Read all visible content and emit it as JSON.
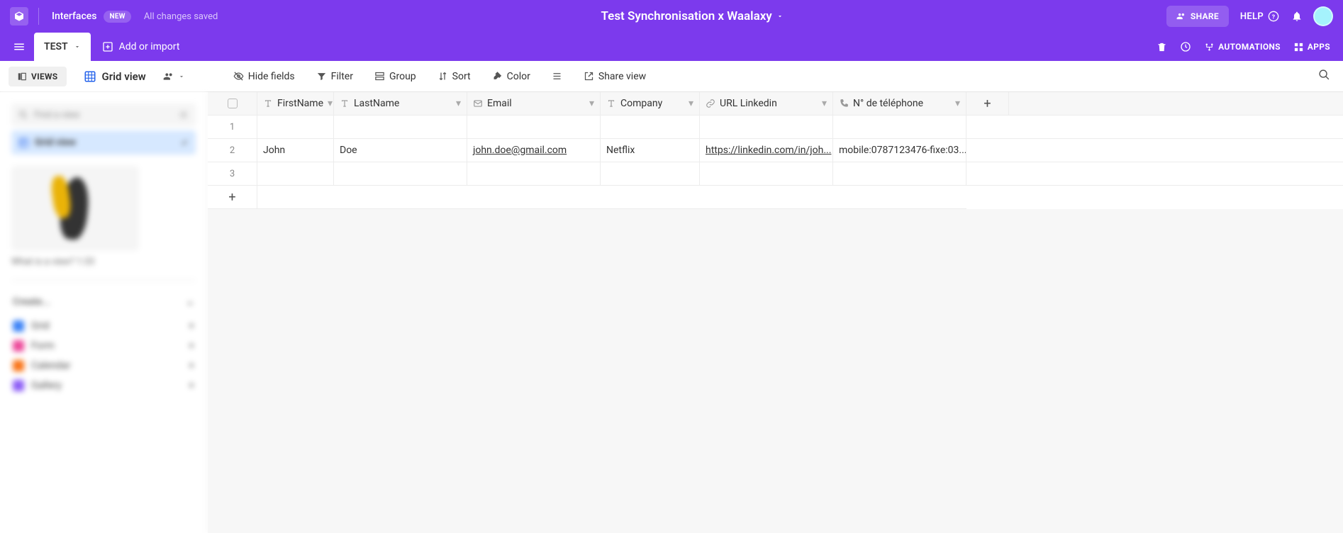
{
  "top": {
    "interfaces": "Interfaces",
    "new": "NEW",
    "saved": "All changes saved",
    "base_title": "Test Synchronisation x Waalaxy",
    "share": "SHARE",
    "help": "HELP"
  },
  "tabs": {
    "active": "TEST",
    "add": "Add or import",
    "trash": "",
    "automations": "AUTOMATIONS",
    "apps": "APPS"
  },
  "toolbar": {
    "views": "VIEWS",
    "gridview": "Grid view",
    "hide": "Hide fields",
    "filter": "Filter",
    "group": "Group",
    "sort": "Sort",
    "color": "Color",
    "share": "Share view"
  },
  "sidebar": {
    "search_ph": "Find a view",
    "active": "Grid view",
    "caption": "What is a view? 1:33",
    "create": "Create...",
    "items": [
      {
        "label": "Grid",
        "color": "#3b82f6"
      },
      {
        "label": "Form",
        "color": "#ec4899"
      },
      {
        "label": "Calendar",
        "color": "#f97316"
      },
      {
        "label": "Gallery",
        "color": "#8b5cf6"
      }
    ]
  },
  "grid": {
    "columns": [
      "FirstName",
      "LastName",
      "Email",
      "Company",
      "URL Linkedin",
      "N° de téléphone"
    ],
    "rows": [
      {
        "n": "1",
        "c": [
          "",
          "",
          "",
          "",
          "",
          ""
        ]
      },
      {
        "n": "2",
        "c": [
          "John",
          "Doe",
          "john.doe@gmail.com",
          "Netflix",
          "https://linkedin.com/in/joh...",
          "mobile:0787123476-fixe:03..."
        ]
      },
      {
        "n": "3",
        "c": [
          "",
          "",
          "",
          "",
          "",
          ""
        ]
      }
    ]
  }
}
